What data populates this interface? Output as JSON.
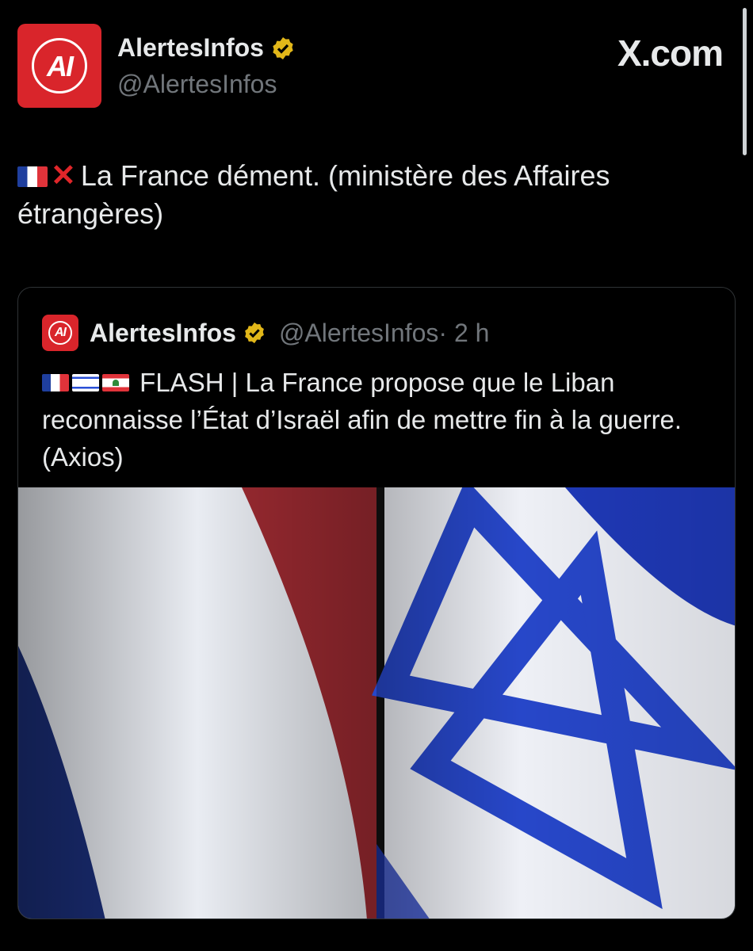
{
  "tweet": {
    "author_name": "AlertesInfos",
    "author_handle": "@AlertesInfos",
    "avatar_text": "AI",
    "source": "X.com",
    "text": "La France dément. (ministère des Affaires étrangères)",
    "emojis": [
      "flag-france",
      "cross-mark"
    ]
  },
  "quoted": {
    "author_name": "AlertesInfos",
    "author_handle": "@AlertesInfos",
    "time": "· 2 h",
    "text": "FLASH | La France propose que le Liban reconnaisse l’État d’Israël afin de mettre fin à la guerre. (Axios)",
    "emojis": [
      "flag-france",
      "flag-israel",
      "flag-lebanon"
    ],
    "image": "French flag and Israeli flag side by side"
  },
  "colors": {
    "background": "#000000",
    "text": "#e7e9ea",
    "muted": "#71767b",
    "verified": "#e2b719",
    "brand_red": "#d9252b"
  }
}
